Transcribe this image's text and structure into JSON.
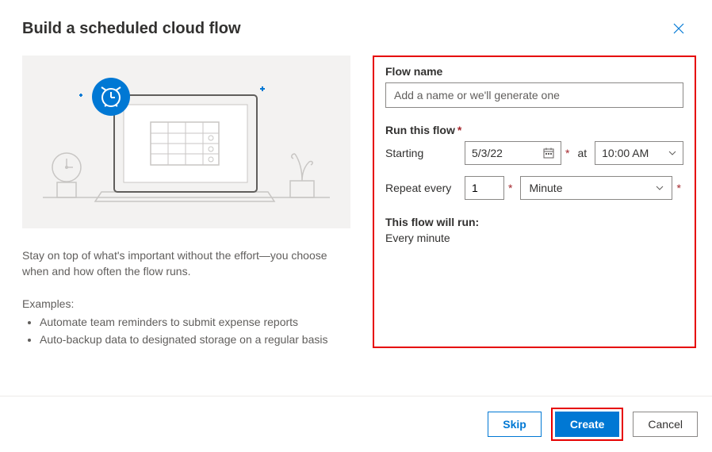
{
  "header": {
    "title": "Build a scheduled cloud flow"
  },
  "left": {
    "description": "Stay on top of what's important without the effort—you choose when and how often the flow runs.",
    "examples_label": "Examples:",
    "examples": [
      "Automate team reminders to submit expense reports",
      "Auto-backup data to designated storage on a regular basis"
    ]
  },
  "form": {
    "flow_name_label": "Flow name",
    "flow_name_placeholder": "Add a name or we'll generate one",
    "run_label": "Run this flow",
    "starting_label": "Starting",
    "starting_date": "5/3/22",
    "at_label": "at",
    "starting_time": "10:00 AM",
    "repeat_label": "Repeat every",
    "repeat_value": "1",
    "repeat_unit": "Minute",
    "summary_label": "This flow will run:",
    "summary_text": "Every minute"
  },
  "footer": {
    "skip": "Skip",
    "create": "Create",
    "cancel": "Cancel"
  }
}
